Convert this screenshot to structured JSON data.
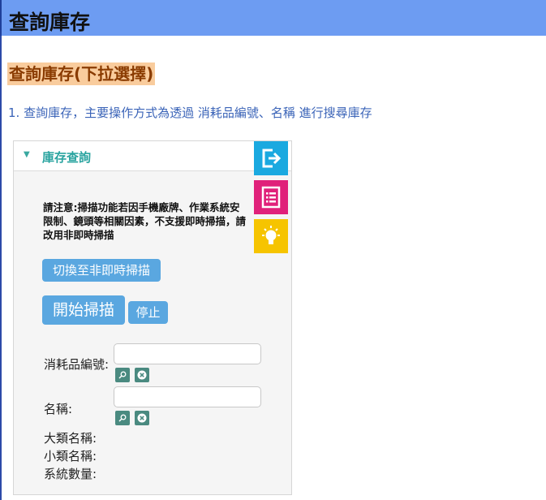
{
  "header": {
    "title": "查詢庫存"
  },
  "section": {
    "title": "查詢庫存(下拉選擇)"
  },
  "description": "1. 查詢庫存，主要操作方式為透過 消耗品編號、名稱 進行搜尋庫存",
  "panel": {
    "title": "庫存查詢",
    "notice": "請注意:掃描功能若因手機廠牌、作業系統安\n限制、鏡頭等相關因素，不支援即時掃描，請\n改用非即時掃描",
    "buttons": {
      "switch_label": "切換至非即時掃描",
      "start_label": "開始掃描",
      "stop_label": "停止"
    },
    "fields": {
      "item_number_label": "消耗品編號:",
      "item_number_value": "",
      "name_label": "名稱:",
      "name_value": ""
    },
    "info": {
      "category_label": "大類名稱:",
      "subcategory_label": "小類名稱:",
      "system_qty_label": "系統數量:"
    }
  },
  "side_buttons": [
    {
      "icon": "exit-icon",
      "color": "#1aa9e0"
    },
    {
      "icon": "list-icon",
      "color": "#e0217a"
    },
    {
      "icon": "lightbulb-icon",
      "color": "#f6c400"
    }
  ],
  "mini_icons": [
    "search-icon",
    "clear-icon"
  ]
}
